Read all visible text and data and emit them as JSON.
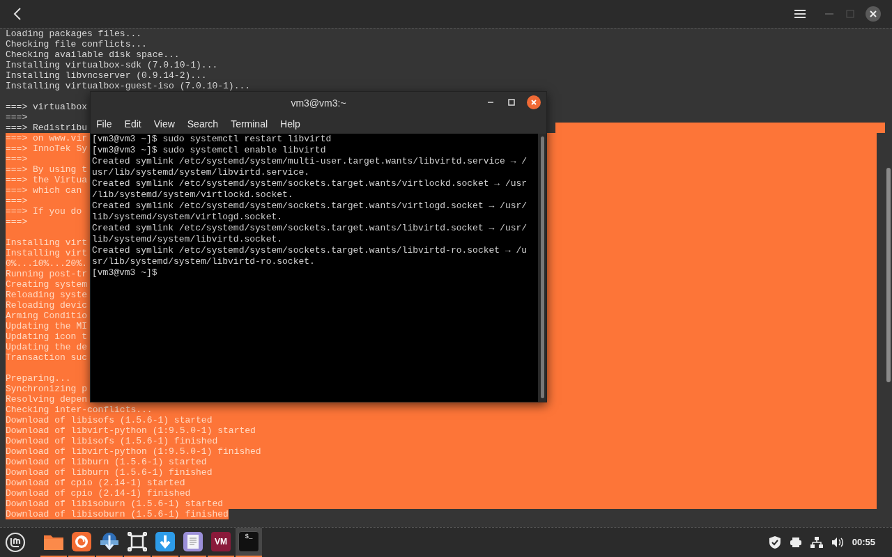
{
  "log": {
    "lines": [
      {
        "kind": "line",
        "text": "Loading packages files...",
        "selected": false
      },
      {
        "kind": "line",
        "text": "Checking file conflicts...",
        "selected": false
      },
      {
        "kind": "line",
        "text": "Checking available disk space...",
        "selected": false
      },
      {
        "kind": "line",
        "text": "Installing virtualbox-sdk (7.0.10-1)...",
        "selected": false
      },
      {
        "kind": "line",
        "text": "Installing libvncserver (0.9.14-2)...",
        "selected": false
      },
      {
        "kind": "line",
        "text": "Installing virtualbox-guest-iso (7.0.10-1)...",
        "selected": false
      },
      {
        "kind": "line",
        "selected": false
      },
      {
        "kind": "line",
        "text": "===> virtualbox",
        "selected": false
      },
      {
        "kind": "line",
        "text": "===>",
        "selected": false
      },
      {
        "kind": "tail",
        "text": "===> Redistribu",
        "selected": true
      },
      {
        "kind": "line",
        "text": "===> on www.vir",
        "selected": true
      },
      {
        "kind": "line",
        "text": "===> InnoTek Sy",
        "selected": true
      },
      {
        "kind": "line",
        "text": "===>",
        "selected": true
      },
      {
        "kind": "line",
        "text": "===> By using t",
        "selected": true
      },
      {
        "kind": "line",
        "text": "===> the Virtua",
        "selected": true
      },
      {
        "kind": "line",
        "text": "===> which can",
        "selected": true
      },
      {
        "kind": "line",
        "text": "===>",
        "selected": true
      },
      {
        "kind": "line",
        "text": "===> If you do",
        "selected": true
      },
      {
        "kind": "line",
        "text": "===>",
        "selected": true
      },
      {
        "kind": "line",
        "selected": true
      },
      {
        "kind": "line",
        "text": "Installing virt",
        "selected": true
      },
      {
        "kind": "line",
        "text": "Installing virt",
        "selected": true
      },
      {
        "kind": "line",
        "text": "0%...10%...20%.",
        "selected": true
      },
      {
        "kind": "line",
        "text": "Running post-tr",
        "selected": true
      },
      {
        "kind": "line",
        "text": "Creating system",
        "selected": true
      },
      {
        "kind": "line",
        "text": "Reloading syste",
        "selected": true
      },
      {
        "kind": "line",
        "text": "Reloading devic",
        "selected": true
      },
      {
        "kind": "line",
        "text": "Arming Conditio",
        "selected": true
      },
      {
        "kind": "line",
        "text": "Updating the MI",
        "selected": true
      },
      {
        "kind": "line",
        "text": "Updating icon t",
        "selected": true
      },
      {
        "kind": "line",
        "text": "Updating the de",
        "selected": true
      },
      {
        "kind": "line",
        "text": "Transaction suc",
        "selected": true
      },
      {
        "kind": "line",
        "selected": true
      },
      {
        "kind": "line",
        "text": "Preparing...",
        "selected": true
      },
      {
        "kind": "line",
        "text": "Synchronizing p",
        "selected": true
      },
      {
        "kind": "line",
        "text": "Resolving depen",
        "selected": true
      },
      {
        "kind": "line",
        "text": "Checking inter-conflicts...",
        "selected": true
      },
      {
        "kind": "line",
        "text": "Download of libisofs (1.5.6-1) started",
        "selected": true
      },
      {
        "kind": "line",
        "text": "Download of libvirt-python (1:9.5.0-1) started",
        "selected": true
      },
      {
        "kind": "line",
        "text": "Download of libisofs (1.5.6-1) finished",
        "selected": true
      },
      {
        "kind": "line",
        "text": "Download of libvirt-python (1:9.5.0-1) finished",
        "selected": true
      },
      {
        "kind": "line",
        "text": "Download of libburn (1.5.6-1) started",
        "selected": true
      },
      {
        "kind": "line",
        "text": "Download of libburn (1.5.6-1) finished",
        "selected": true
      },
      {
        "kind": "line",
        "text": "Download of cpio (2.14-1) started",
        "selected": true
      },
      {
        "kind": "line",
        "text": "Download of cpio (2.14-1) finished",
        "selected": true
      },
      {
        "kind": "line",
        "text": "Download of libisoburn (1.5.6-1) started",
        "selected": true
      },
      {
        "kind": "head",
        "text": "Download of libisoburn (1.5.6-1) finished",
        "selected": true
      }
    ]
  },
  "terminal": {
    "title": "vm3@vm3:~",
    "menu": [
      "File",
      "Edit",
      "View",
      "Search",
      "Terminal",
      "Help"
    ],
    "lines": [
      "[vm3@vm3 ~]$ sudo systemctl restart libvirtd",
      "[vm3@vm3 ~]$ sudo systemctl enable libvirtd",
      "Created symlink /etc/systemd/system/multi-user.target.wants/libvirtd.service → /",
      "usr/lib/systemd/system/libvirtd.service.",
      "Created symlink /etc/systemd/system/sockets.target.wants/virtlockd.socket → /usr",
      "/lib/systemd/system/virtlockd.socket.",
      "Created symlink /etc/systemd/system/sockets.target.wants/virtlogd.socket → /usr/",
      "lib/systemd/system/virtlogd.socket.",
      "Created symlink /etc/systemd/system/sockets.target.wants/libvirtd.socket → /usr/",
      "lib/systemd/system/libvirtd.socket.",
      "Created symlink /etc/systemd/system/sockets.target.wants/libvirtd-ro.socket → /u",
      "sr/lib/systemd/system/libvirtd-ro.socket.",
      "[vm3@vm3 ~]$"
    ]
  },
  "taskbar": {
    "apps": [
      {
        "kind": "folder",
        "running": true,
        "active": false
      },
      {
        "kind": "browser",
        "running": true,
        "active": false
      },
      {
        "kind": "transfer",
        "running": true,
        "active": false
      },
      {
        "kind": "frame",
        "running": true,
        "active": false
      },
      {
        "kind": "download",
        "running": true,
        "active": false
      },
      {
        "kind": "document",
        "running": true,
        "active": false
      },
      {
        "kind": "vm",
        "label": "VM",
        "running": true,
        "active": false
      },
      {
        "kind": "terminal",
        "label": "$_",
        "running": true,
        "active": true
      }
    ],
    "clock": "00:55"
  }
}
